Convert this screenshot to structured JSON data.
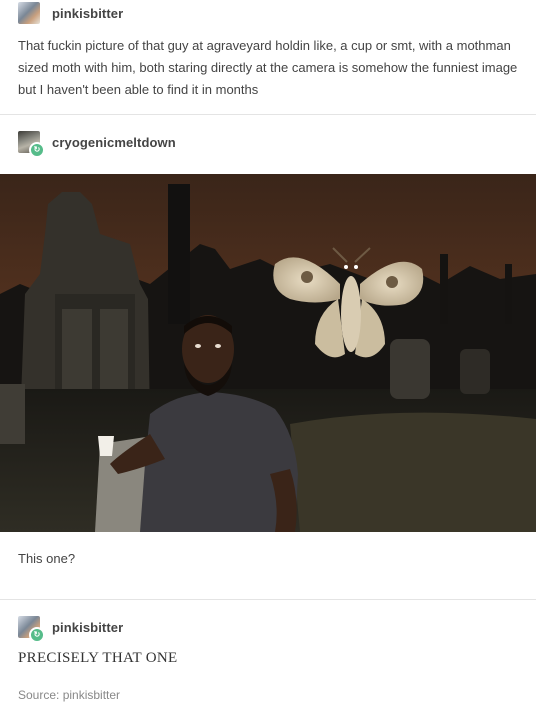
{
  "posts": [
    {
      "username": "pinkisbitter",
      "text": "That fuckin picture of that guy at agraveyard holdin like, a cup or smt, with a mothman sized moth with him, both staring directly at the camera is somehow the funniest image but I haven't been able to find it in months"
    },
    {
      "username": "cryogenicmeltdown",
      "text": "This one?"
    },
    {
      "username": "pinkisbitter",
      "text": "PRECISELY THAT ONE"
    }
  ],
  "source": "Source: pinkisbitter",
  "photo": {
    "description_icon": "graveyard-moth-photo"
  }
}
